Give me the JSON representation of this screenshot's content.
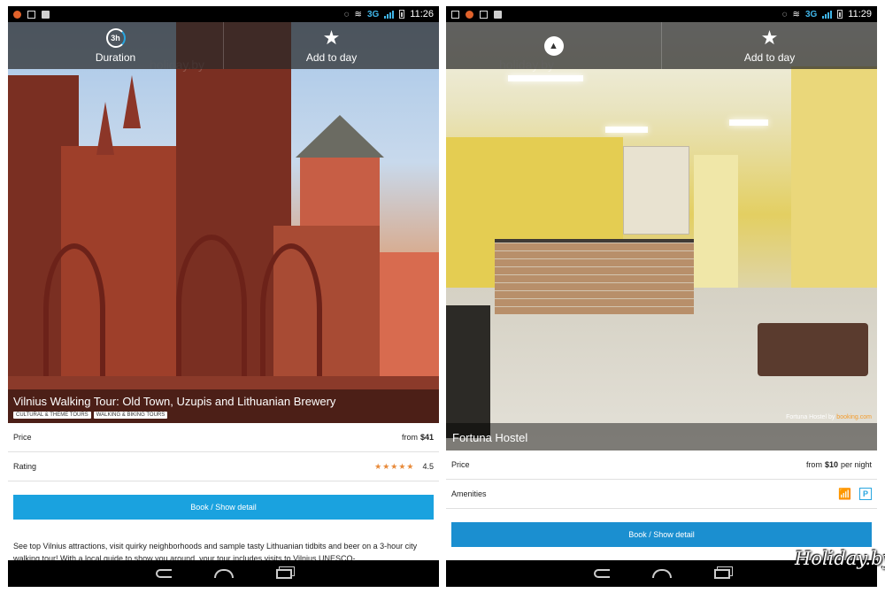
{
  "left": {
    "status": {
      "network": "3G",
      "time": "11:26"
    },
    "action_bar": {
      "duration_badge": "3h",
      "duration_label": "Duration",
      "add_label": "Add to day"
    },
    "watermark": "holiday.by",
    "title": "Vilnius Walking Tour: Old Town, Uzupis and Lithuanian Brewery",
    "tags": [
      "CULTURAL & THEME TOURS",
      "WALKING & BIKING TOURS"
    ],
    "price": {
      "label": "Price",
      "prefix": "from",
      "value": "$41"
    },
    "rating": {
      "label": "Rating",
      "stars": "★★★★★",
      "value": "4.5"
    },
    "book_label": "Book / Show detail",
    "description": "See top Vilnius attractions, visit quirky neighborhoods and sample tasty Lithuanian tidbits and beer on a 3-hour city walking tour! With a local guide to show you around, your tour includes visits to Vilnius UNESCO-"
  },
  "right": {
    "status": {
      "network": "3G",
      "time": "11:29"
    },
    "action_bar": {
      "add_label": "Add to day"
    },
    "watermark": "holiday.by",
    "title": "Fortuna Hostel",
    "credit_text": "Fortuna Hostel by",
    "credit_link": "booking.com",
    "price": {
      "label": "Price",
      "prefix": "from",
      "value": "$10",
      "suffix": "per night"
    },
    "amenities": {
      "label": "Amenities",
      "parking": "P"
    },
    "book_label": "Book / Show detail"
  },
  "logo": "Holiday.by",
  "colors": {
    "accent": "#1aa2df",
    "star": "#e88a3a"
  }
}
